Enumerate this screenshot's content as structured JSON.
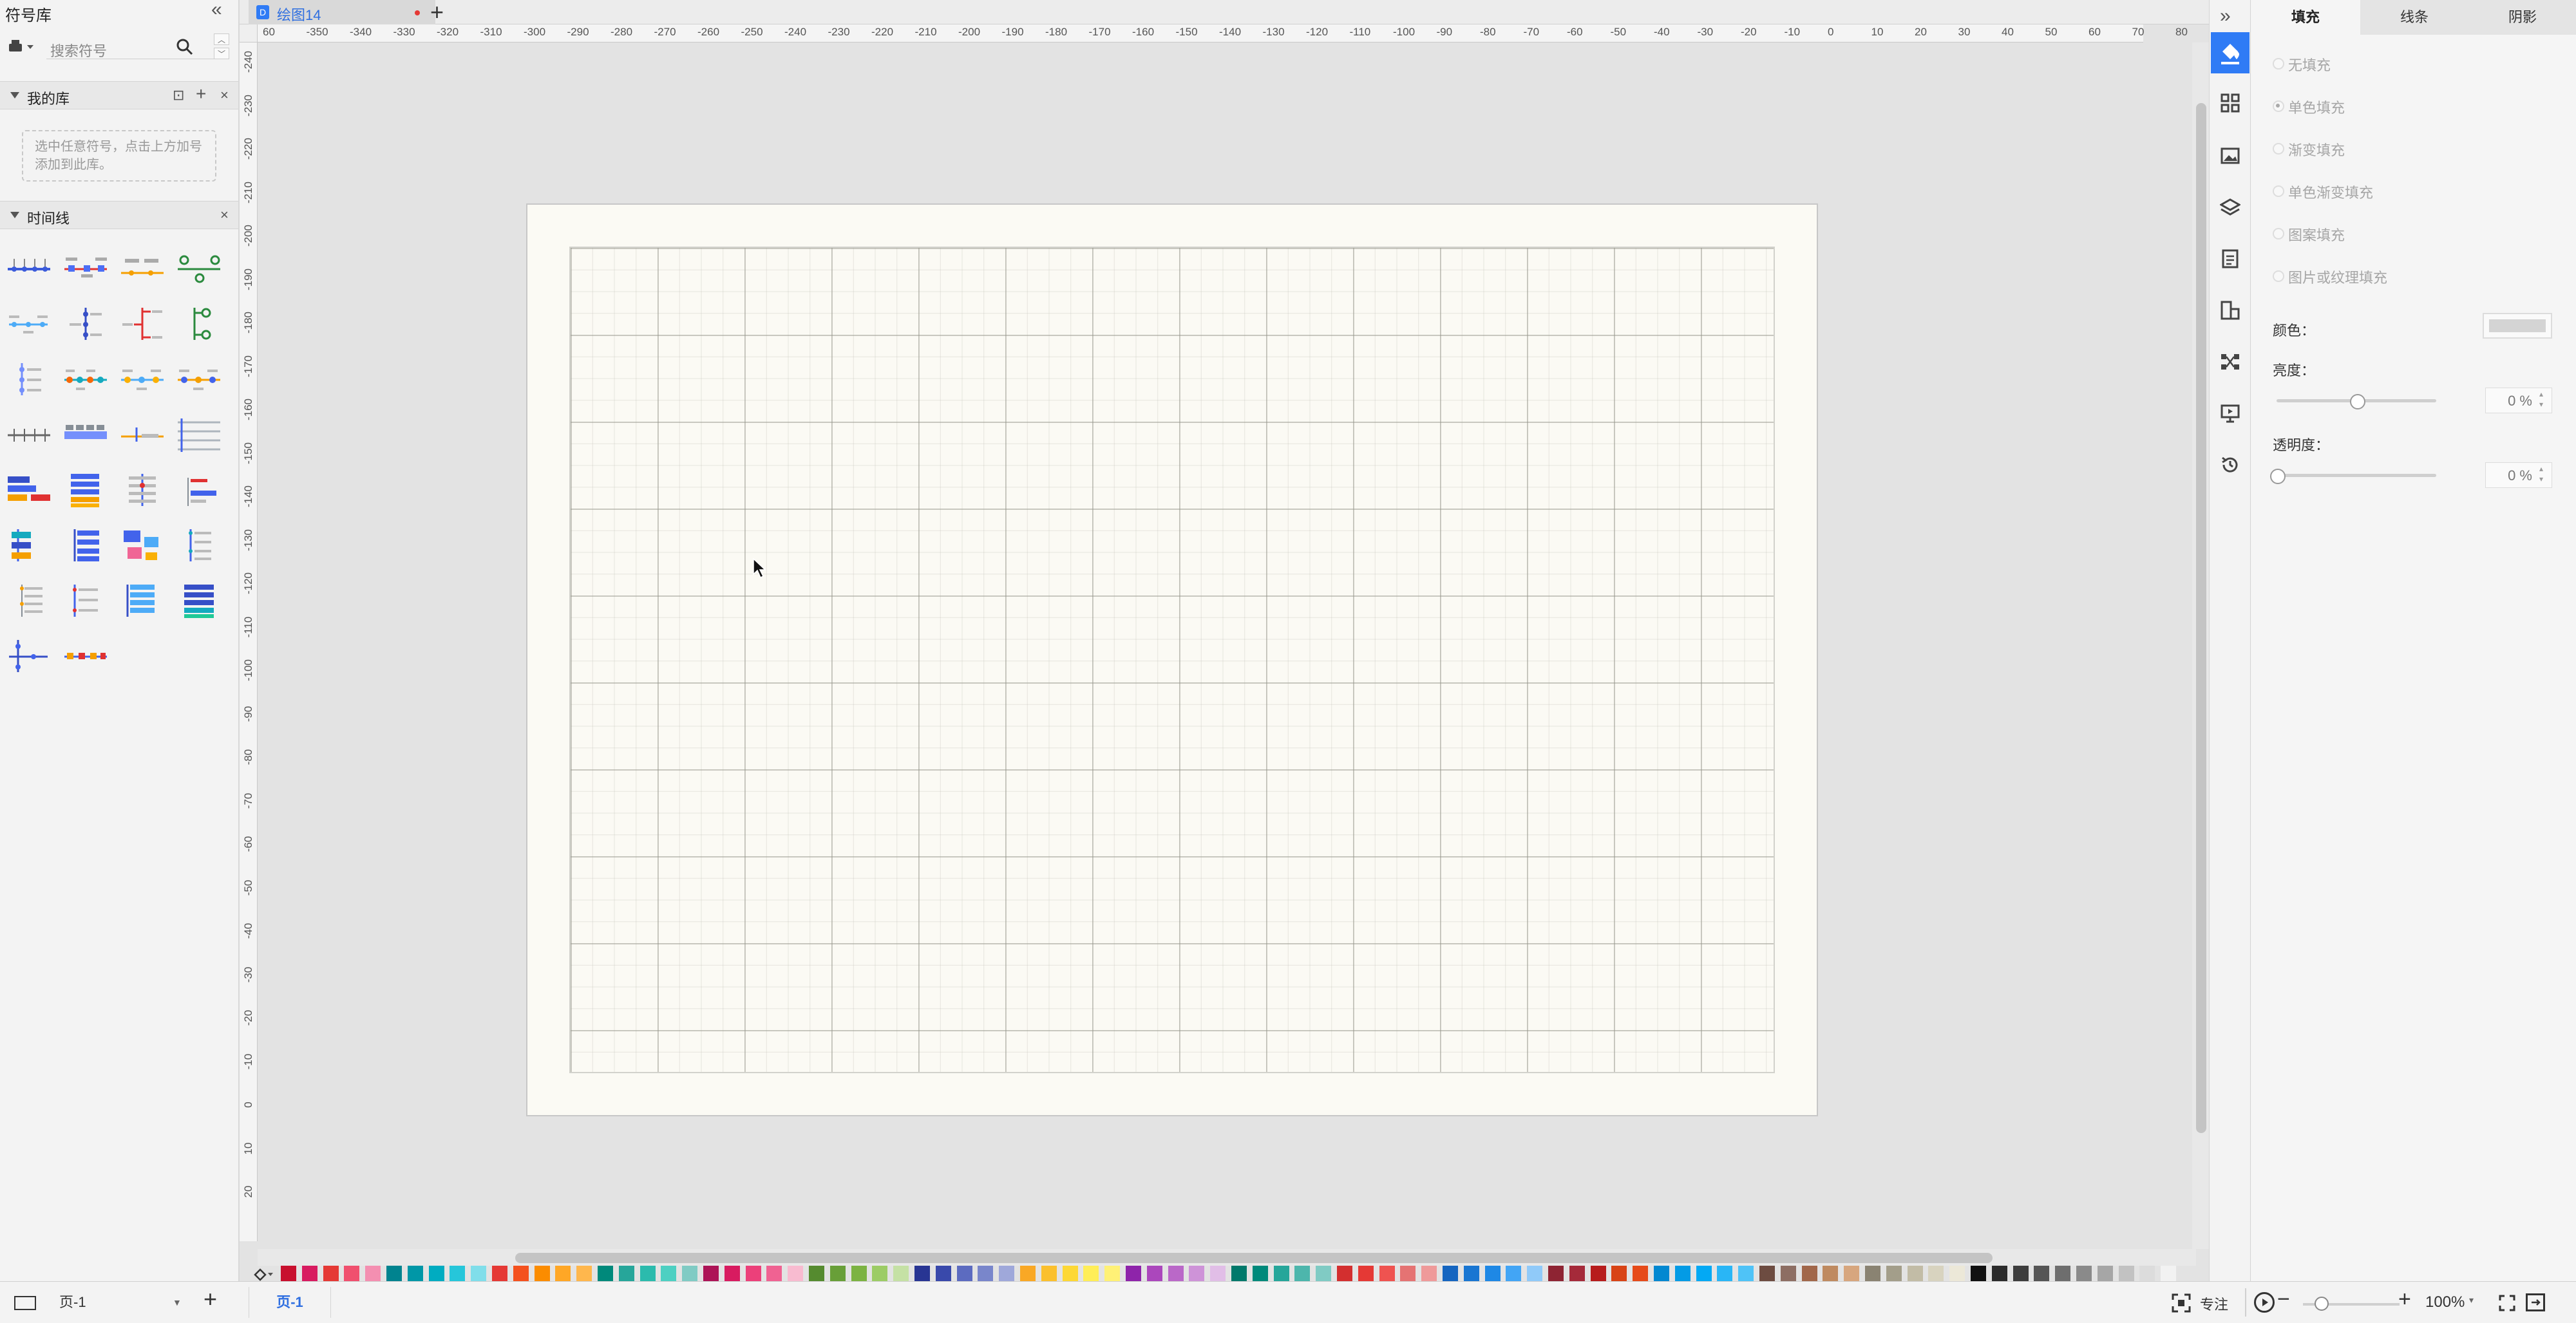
{
  "left_panel": {
    "title": "符号库",
    "search_placeholder": "搜索符号",
    "my_library": {
      "title": "我的库",
      "hint": "选中任意符号，点击上方加号添加到此库。"
    },
    "timeline": {
      "title": "时间线"
    }
  },
  "tabs": [
    {
      "label": "绘图14",
      "modified": true
    }
  ],
  "ruler": {
    "h_ticks": [
      "60",
      "-350",
      "-340",
      "-330",
      "-320",
      "-310",
      "-300",
      "-290",
      "-280",
      "-270",
      "-260",
      "-250",
      "-240",
      "-230",
      "-220",
      "-210",
      "-200",
      "-190",
      "-180",
      "-170",
      "-160",
      "-150",
      "-140",
      "-130",
      "-120",
      "-110",
      "-100",
      "-90",
      "-80",
      "-70",
      "-60",
      "-50",
      "-40",
      "-30",
      "-20",
      "-10",
      "0",
      "10",
      "20",
      "30",
      "40",
      "50",
      "60",
      "70",
      "80"
    ],
    "v_ticks": [
      "-240",
      "-230",
      "-220",
      "-210",
      "-200",
      "-190",
      "-180",
      "-170",
      "-160",
      "-150",
      "-140",
      "-130",
      "-120",
      "-110",
      "-100",
      "-90",
      "-80",
      "-70",
      "-60",
      "-50",
      "-40",
      "-30",
      "-20",
      "-10",
      "0",
      "10",
      "20"
    ]
  },
  "status": {
    "page_select": "页-1",
    "page_tab": "页-1",
    "focus_label": "专注",
    "zoom": "100%"
  },
  "right_panel": {
    "tabs": [
      "填充",
      "线条",
      "阴影"
    ],
    "active_tab": "填充",
    "fill_options": [
      "无填充",
      "单色填充",
      "渐变填充",
      "单色渐变填充",
      "图案填充",
      "图片或纹理填充"
    ],
    "selected_fill": "单色填充",
    "color_label": "颜色：",
    "brightness_label": "亮度：",
    "brightness_value": "0 %",
    "brightness_level": 0.5,
    "transparency_label": "透明度：",
    "transparency_value": "0 %",
    "transparency_level": 0
  },
  "palette": [
    "#c8102e",
    "#d81b60",
    "#e53935",
    "#f0506e",
    "#f48fb1",
    "#00838f",
    "#0097a7",
    "#00acc1",
    "#26c6da",
    "#80deea",
    "#e53935",
    "#f4511e",
    "#fb8c00",
    "#ffa726",
    "#ffb74d",
    "#00897b",
    "#26a69a",
    "#2bbbad",
    "#4dd0c2",
    "#80cbc4",
    "#ad1457",
    "#d81b60",
    "#ec407a",
    "#f06292",
    "#f8bbd0",
    "#558b2f",
    "#689f38",
    "#7cb342",
    "#9ccc65",
    "#c5e1a5",
    "#283593",
    "#3949ab",
    "#5c6bc0",
    "#7986cb",
    "#9fa8da",
    "#f9a825",
    "#fbc02d",
    "#fdd835",
    "#ffee58",
    "#fff176",
    "#8e24aa",
    "#ab47bc",
    "#ba68c8",
    "#ce93d8",
    "#e1bee7",
    "#00796b",
    "#00897b",
    "#26a69a",
    "#4db6ac",
    "#80cbc4",
    "#d32f2f",
    "#e53935",
    "#ef5350",
    "#e57373",
    "#ef9a9a",
    "#1565c0",
    "#1976d2",
    "#1e88e5",
    "#42a5f5",
    "#90caf9",
    "#8e2433",
    "#a52a3a",
    "#b71c1c",
    "#d84315",
    "#e64a19",
    "#0288d1",
    "#039be5",
    "#03a9f4",
    "#29b6f6",
    "#4fc3f7",
    "#6d4c41",
    "#8d6e63",
    "#a1674a",
    "#bf8a60",
    "#d7a67e",
    "#8a8372",
    "#a39e8a",
    "#c2bca6",
    "#d8d3bf",
    "#ece8d8",
    "#111111",
    "#2b2b2b",
    "#3d3d3d",
    "#555555",
    "#6e6e6e",
    "#8a8a8a",
    "#a6a6a6",
    "#c2c2c2",
    "#dcdcdc",
    "#f2f2f2"
  ]
}
